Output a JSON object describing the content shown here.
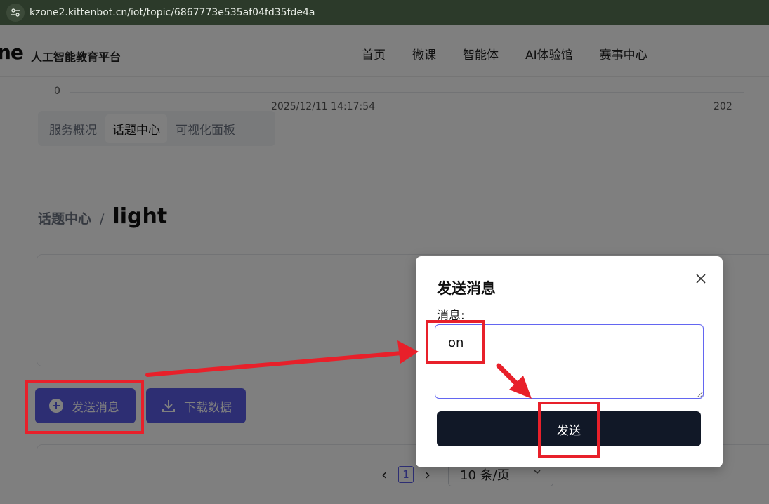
{
  "browser": {
    "url": "kzone2.kittenbot.cn/iot/topic/6867773e535af04fd35fde4a"
  },
  "header": {
    "logo_fragment": "ne",
    "platform_name": "人工智能教育平台",
    "nav": [
      "首页",
      "微课",
      "智能体",
      "AI体验馆",
      "赛事中心"
    ]
  },
  "tabs": [
    {
      "label": "服务概况",
      "active": false
    },
    {
      "label": "话题中心",
      "active": true
    },
    {
      "label": "可视化面板",
      "active": false
    }
  ],
  "breadcrumb": {
    "parent": "话题中心",
    "separator": "/",
    "current": "light"
  },
  "chart": {
    "y_tick": "0",
    "x_ticks": [
      "2025/12/11 14:17:54",
      "202"
    ]
  },
  "actions": {
    "send_label": "发送消息",
    "download_label": "下载数据"
  },
  "pagination": {
    "prev": "‹",
    "current_page": "1",
    "next": "›",
    "page_size": "10 条/页"
  },
  "modal": {
    "title": "发送消息",
    "field_label": "消息:",
    "message_value": "on",
    "submit_label": "发送"
  },
  "colors": {
    "accent": "#5b5ce6",
    "annotation": "#e8202a",
    "submit": "#111827"
  }
}
